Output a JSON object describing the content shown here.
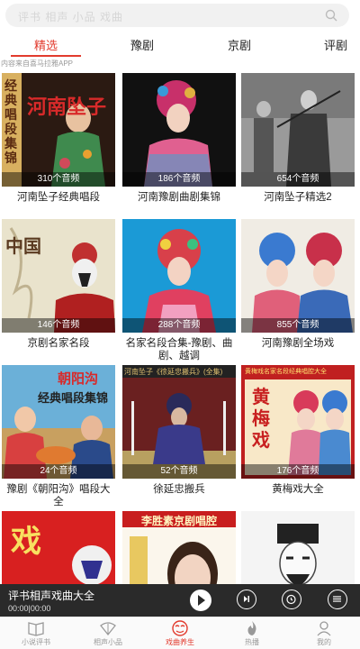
{
  "search": {
    "placeholder": "评书  相声  小品  戏曲"
  },
  "tabs": [
    {
      "label": "精选",
      "active": true
    },
    {
      "label": "豫剧",
      "active": false
    },
    {
      "label": "京剧",
      "active": false
    },
    {
      "label": "评剧",
      "active": false
    }
  ],
  "notice": "内容来自喜马拉雅APP",
  "cards": [
    {
      "title": "河南坠子经典唱段",
      "count": "310个音频",
      "overlay": "河南坠子",
      "side": "经典唱段集锦"
    },
    {
      "title": "河南豫剧曲剧集锦",
      "count": "186个音频"
    },
    {
      "title": "河南坠子精选2",
      "count": "654个音频"
    },
    {
      "title": "京剧名家名段",
      "count": "146个音频",
      "overlay": "中国"
    },
    {
      "title": "名家名段合集-豫剧、曲剧、越调",
      "count": "288个音频"
    },
    {
      "title": "河南豫剧全场戏",
      "count": "855个音频"
    },
    {
      "title": "豫剧《朝阳沟》唱段大全",
      "count": "24个音频",
      "overlay": "朝阳沟",
      "side": "经典唱段集锦"
    },
    {
      "title": "徐延忠搬兵",
      "count": "52个音频",
      "overlay": "河南坠子《徐延忠搬兵》(全集)"
    },
    {
      "title": "黄梅戏大全",
      "count": "176个音频",
      "overlay": "黄梅戏",
      "side": "黄梅戏名家名段经典唱腔大全"
    },
    {
      "title": "",
      "count": "",
      "overlay": "戏"
    },
    {
      "title": "",
      "count": "",
      "overlay": "李胜素京剧唱腔"
    },
    {
      "title": "",
      "count": ""
    }
  ],
  "player": {
    "title": "评书相声戏曲大全",
    "time": "00:00|00:00"
  },
  "nav": [
    {
      "label": "小说评书",
      "icon": "book-icon",
      "active": false
    },
    {
      "label": "相声小品",
      "icon": "fan-icon",
      "active": false
    },
    {
      "label": "戏曲养生",
      "icon": "opera-mask-icon",
      "active": true
    },
    {
      "label": "热播",
      "icon": "flame-icon",
      "active": false
    },
    {
      "label": "我的",
      "icon": "user-icon",
      "active": false
    }
  ],
  "colors": {
    "accent": "#e23b2e",
    "player_bg": "#2a2a2a"
  }
}
